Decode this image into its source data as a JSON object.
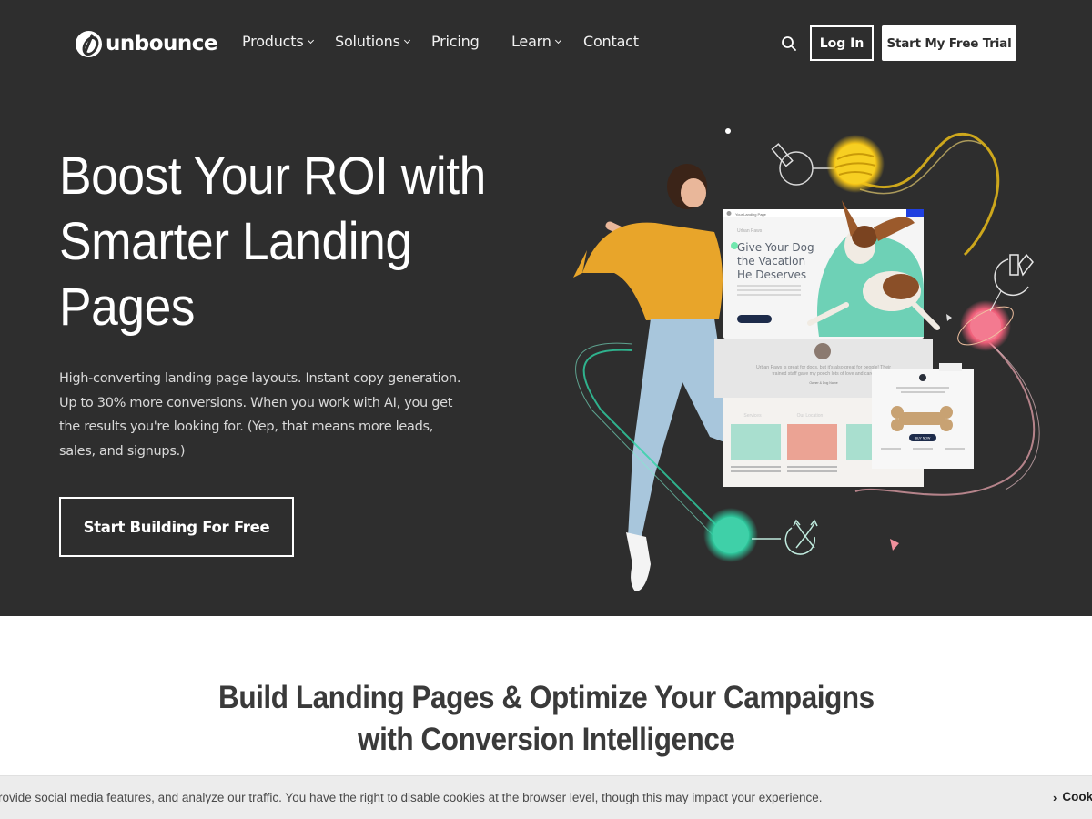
{
  "nav": {
    "logo_text": "unbounce",
    "items": [
      {
        "label": "Products",
        "has_dropdown": true
      },
      {
        "label": "Solutions",
        "has_dropdown": true
      },
      {
        "label": "Pricing",
        "has_dropdown": false
      },
      {
        "label": "Learn",
        "has_dropdown": true
      },
      {
        "label": "Contact",
        "has_dropdown": false
      }
    ],
    "search_icon": "search-icon",
    "login_label": "Log In",
    "trial_label": "Start My Free Trial"
  },
  "hero": {
    "title_lines": [
      "Boost Your ROI with",
      "Smarter Landing",
      "Pages"
    ],
    "subtitle": "High-converting landing page layouts. Instant copy generation. Up to 30% more conversions. When you work with AI, you get the results you're looking for. (Yep, that means more leads, sales, and signups.)",
    "cta_label": "Start Building For Free",
    "mockup": {
      "window_title": "Your Landing Page",
      "brand": "Urban Paws",
      "headline": [
        "Give Your Dog",
        "the Vacation",
        "He Deserves"
      ],
      "testimonial": "Urban Paws is great for dogs, but it's also great for people! Their trained staff gave my pooch lots of love and care.",
      "testimonial_author": "Owner & Dog Name",
      "section_labels": [
        "Services",
        "Our Location"
      ],
      "buy_label": "BUY NOW"
    }
  },
  "section2": {
    "title_lines": [
      "Build Landing Pages & Optimize Your Campaigns",
      "with Conversion Intelligence"
    ]
  },
  "cookie_bar": {
    "text": "rovide social media features, and analyze our traffic. You have the right to disable cookies at the browser level, though this may impact your experience.",
    "link_label": "Cook"
  },
  "colors": {
    "hero_bg": "#2e2e2e",
    "accent_yellow": "#f5c518",
    "accent_teal": "#2fd3a5",
    "accent_pink": "#f07a8a",
    "sweater": "#e8a52a"
  }
}
